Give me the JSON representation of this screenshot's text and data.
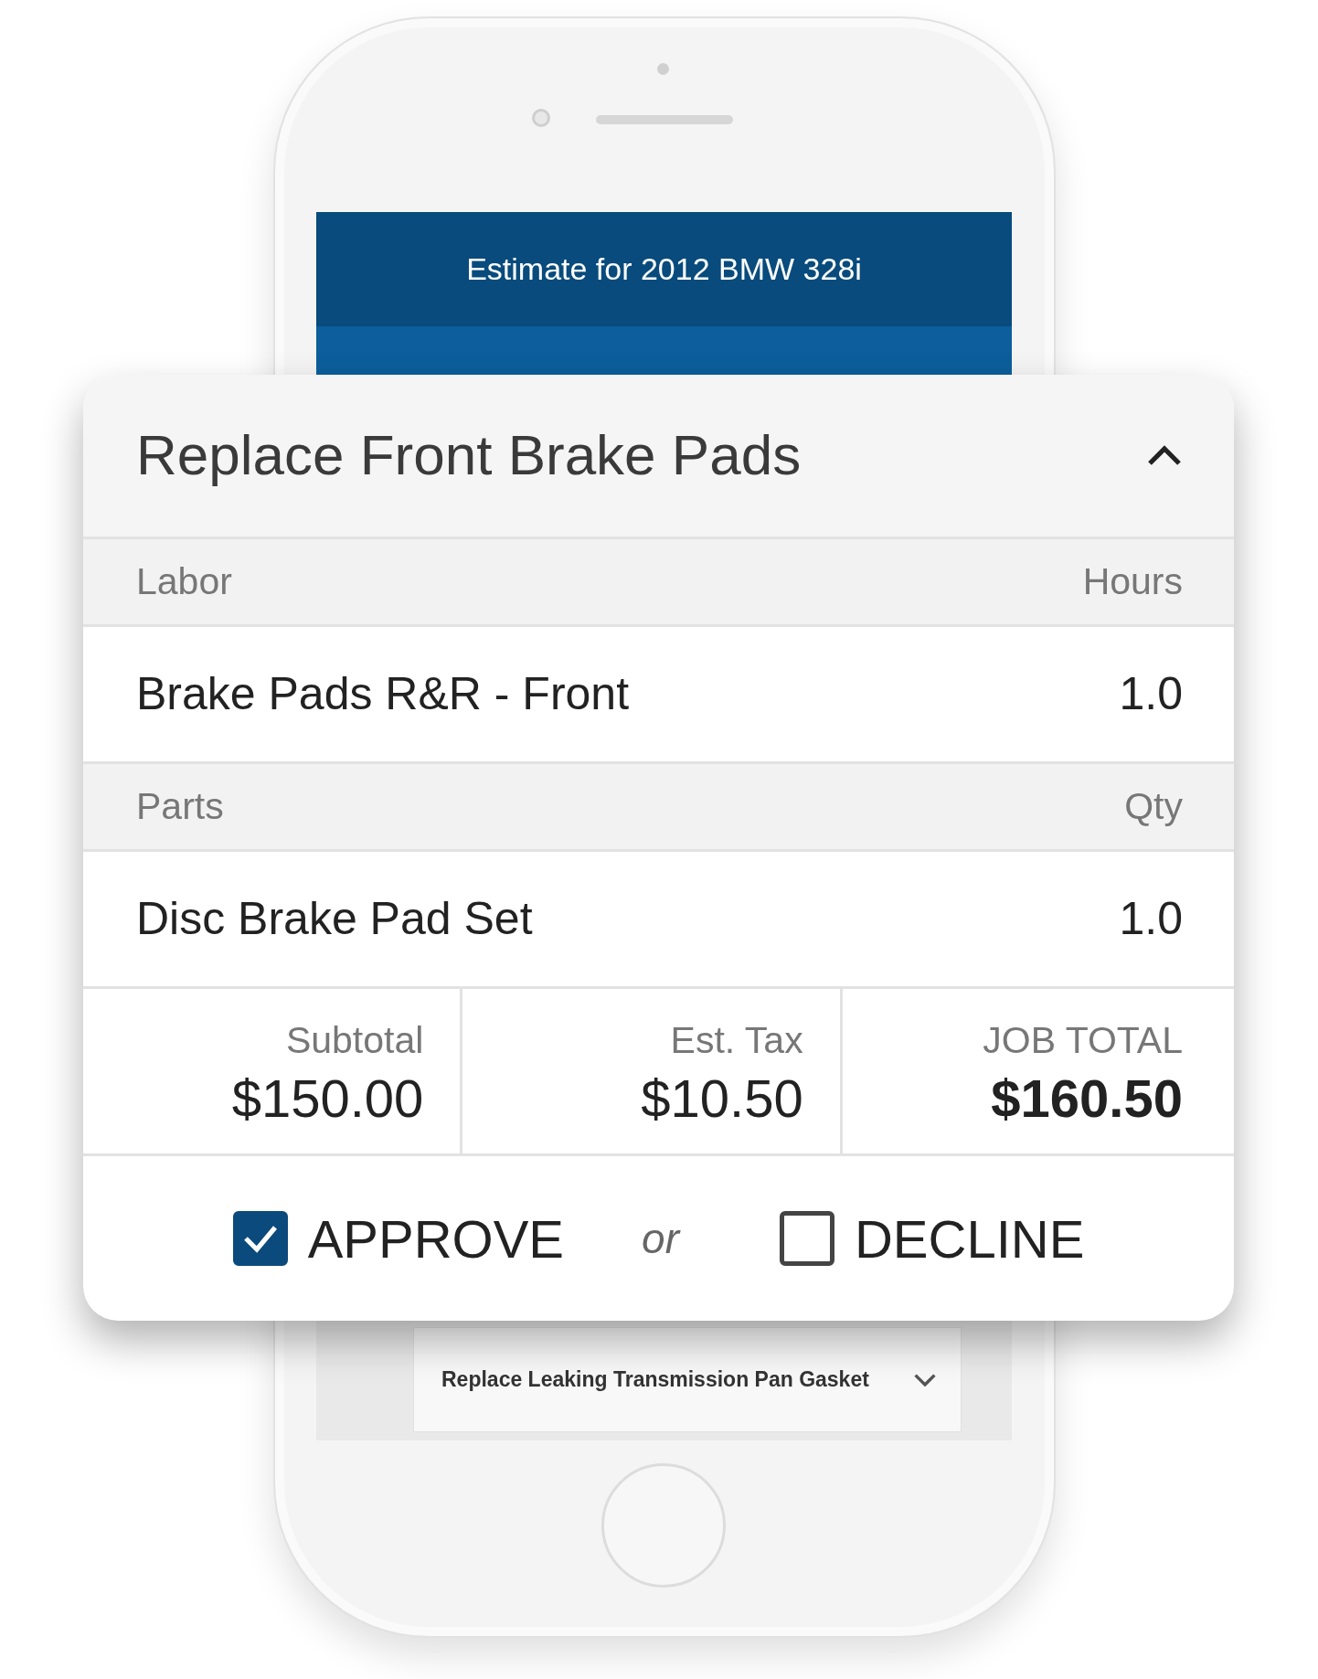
{
  "phone": {
    "header": "Estimate for 2012 BMW 328i",
    "list_items": [
      {
        "text": "Replace Leaking Transmission Pan Gasket",
        "expanded": false
      }
    ]
  },
  "job_card": {
    "title": "Replace Front Brake Pads",
    "expanded": true,
    "sections": [
      {
        "heading": "Labor",
        "column_heading": "Hours",
        "items": [
          {
            "name": "Brake Pads R&R - Front",
            "value": "1.0"
          }
        ]
      },
      {
        "heading": "Parts",
        "column_heading": "Qty",
        "items": [
          {
            "name": "Disc Brake Pad Set",
            "value": "1.0"
          }
        ]
      }
    ],
    "totals": [
      {
        "label": "Subtotal",
        "value": "$150.00",
        "emphasis": false
      },
      {
        "label": "Est. Tax",
        "value": "$10.50",
        "emphasis": false
      },
      {
        "label": "JOB TOTAL",
        "value": "$160.50",
        "emphasis": true
      }
    ],
    "choices": [
      {
        "label": "APPROVE",
        "checked": true
      },
      {
        "label": "DECLINE",
        "checked": false
      }
    ],
    "separator": "or"
  }
}
